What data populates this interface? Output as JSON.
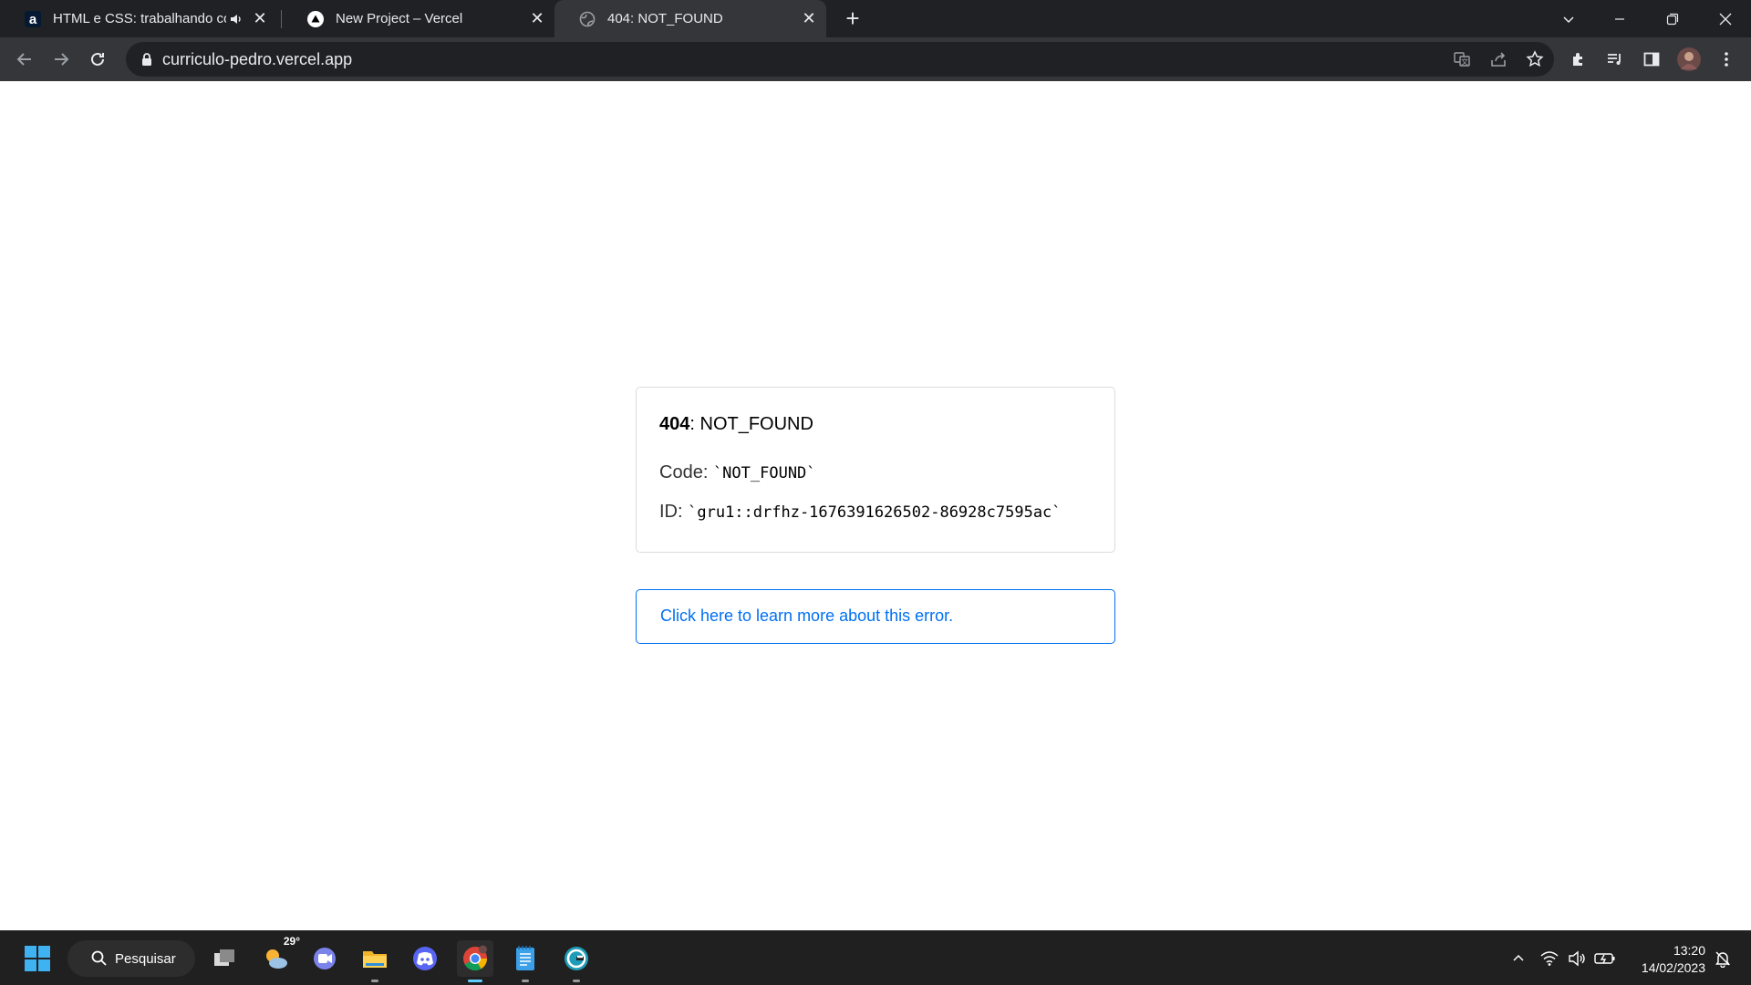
{
  "browser": {
    "tabs": [
      {
        "title": "HTML e CSS: trabalhando com",
        "favicon": "alura-favicon",
        "has_audio": true
      },
      {
        "title": "New Project – Vercel",
        "favicon": "vercel-favicon"
      },
      {
        "title": "404: NOT_FOUND",
        "favicon": "globe-favicon",
        "active": true
      }
    ],
    "new_tab_symbol": "+",
    "url": "curriculo-pedro.vercel.app"
  },
  "page": {
    "status_code": "404",
    "status_text": "NOT_FOUND",
    "code_label": "Code:",
    "code_value": "`NOT_FOUND`",
    "id_label": "ID:",
    "id_value": "`gru1::drfhz-1676391626502-86928c7595ac`",
    "learn_more": "Click here to learn more about this error."
  },
  "taskbar": {
    "search_label": "Pesquisar",
    "weather_temp": "29°",
    "time": "13:20",
    "date": "14/02/2023"
  },
  "colors": {
    "tabstrip_bg": "#202124",
    "toolbar_bg": "#35363a",
    "link_blue": "#0070f3",
    "taskbar_bg": "#202020",
    "taskbar_active": "#60cdff"
  }
}
